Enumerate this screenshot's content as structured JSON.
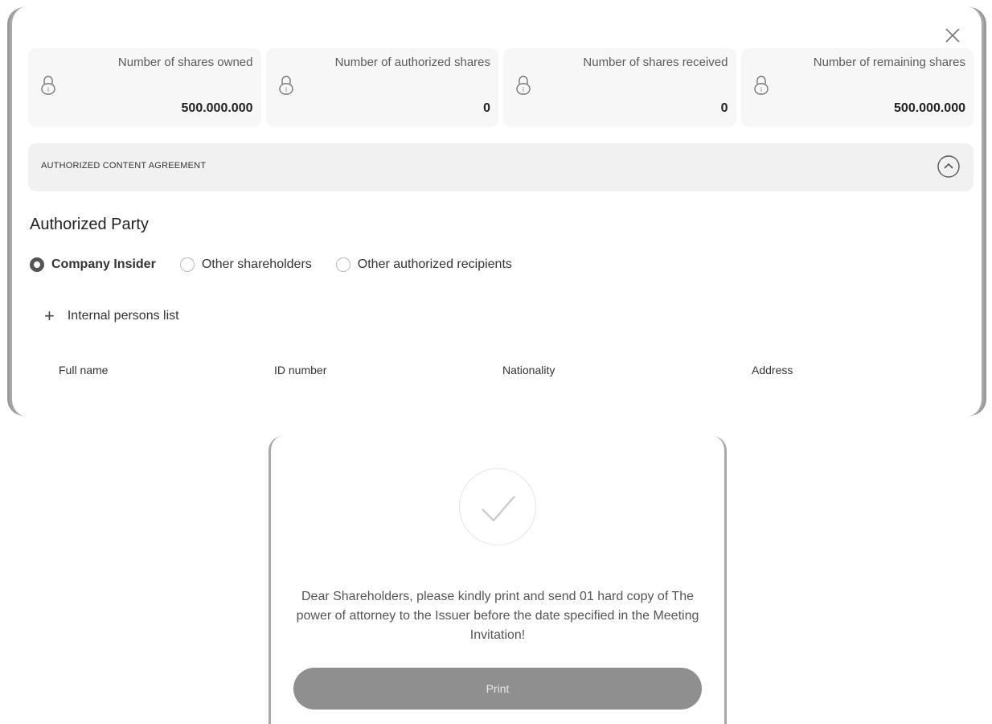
{
  "panel": {
    "stats": [
      {
        "label": "Number of shares owned",
        "value": "500.000.000"
      },
      {
        "label": "Number of authorized shares",
        "value": "0"
      },
      {
        "label": "Number of shares received",
        "value": "0"
      },
      {
        "label": "Number of remaining shares",
        "value": "500.000.000"
      }
    ],
    "agreement": {
      "title": "AUTHORIZED CONTENT AGREEMENT"
    },
    "section_title": "Authorized Party",
    "radios": [
      {
        "label": "Company Insider",
        "checked": true
      },
      {
        "label": "Other shareholders",
        "checked": false
      },
      {
        "label": "Other authorized recipients",
        "checked": false
      }
    ],
    "add_list_label": "Internal persons list",
    "table_columns": [
      "Full name",
      "ID number",
      "Nationality",
      "Address"
    ]
  },
  "dialog": {
    "message": "Dear Shareholders, please kindly print and send 01 hard copy of The power of attorney to the Issuer before the date specified in the Meeting Invitation!",
    "print_label": "Print"
  },
  "icons": {
    "close": "close-icon",
    "lock": "lock-icon",
    "chevron_up": "chevron-up-icon",
    "plus": "plus-icon",
    "check": "check-icon"
  },
  "colors": {
    "print_button": "#8f8f8f",
    "panel_stat_bg": "#f7f7f7",
    "agreement_bg": "#f1f1f1"
  }
}
